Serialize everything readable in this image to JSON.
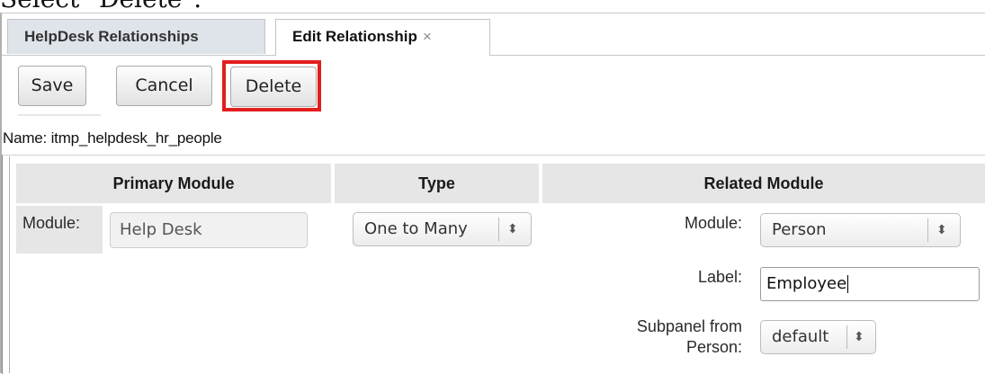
{
  "doc_heading": "Select \"Delete\".",
  "tabs": [
    {
      "label": "HelpDesk Relationships",
      "active": false
    },
    {
      "label": "Edit Relationship",
      "active": true,
      "close_glyph": "×"
    }
  ],
  "toolbar": {
    "save_label": "Save",
    "cancel_label": "Cancel",
    "delete_label": "Delete",
    "highlight_color": "#e21e1e"
  },
  "relationship": {
    "name_line": "Name: itmp_helpdesk_hr_people"
  },
  "table": {
    "headers": {
      "primary": "Primary Module",
      "type": "Type",
      "related": "Related Module"
    },
    "primary": {
      "module_label": "Module:",
      "module_value": "Help Desk"
    },
    "type": {
      "selected": "One to Many"
    },
    "related": {
      "module_label": "Module:",
      "module_selected": "Person",
      "label_label": "Label:",
      "label_value": "Employee",
      "subpanel_label_line1": "Subpanel from",
      "subpanel_label_line2": "Person:",
      "subpanel_selected": "default"
    }
  },
  "icons": {
    "select_arrows": "⬍",
    "close": "×"
  }
}
